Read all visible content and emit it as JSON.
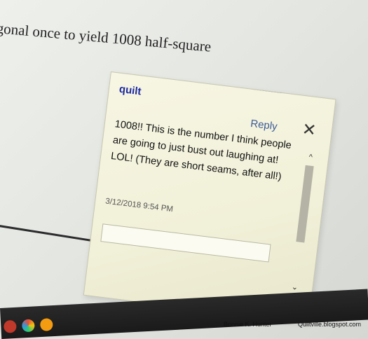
{
  "document": {
    "text_line": "gonal once to yield 1008 half-square"
  },
  "comment": {
    "author": "quilt",
    "reply_label": "Reply",
    "close_glyph": "✕",
    "body": "1008!!  This is the number I think people are going to just bust out laughing at! LOL! (They are short seams, after all!)",
    "date": "3/12/2018  9:54 PM",
    "reply_input_value": "",
    "scroll_up_glyph": "^",
    "scroll_down_glyph": "⌄"
  },
  "footer": {
    "credit": "Bonnie K. Hunter",
    "site": "Quiltville.blogspot.com"
  },
  "colors": {
    "author": "#1d2aa0",
    "reply": "#3c5a96",
    "comment_bg": "#f4f3dd",
    "taskbar": "#1f1f1f"
  }
}
